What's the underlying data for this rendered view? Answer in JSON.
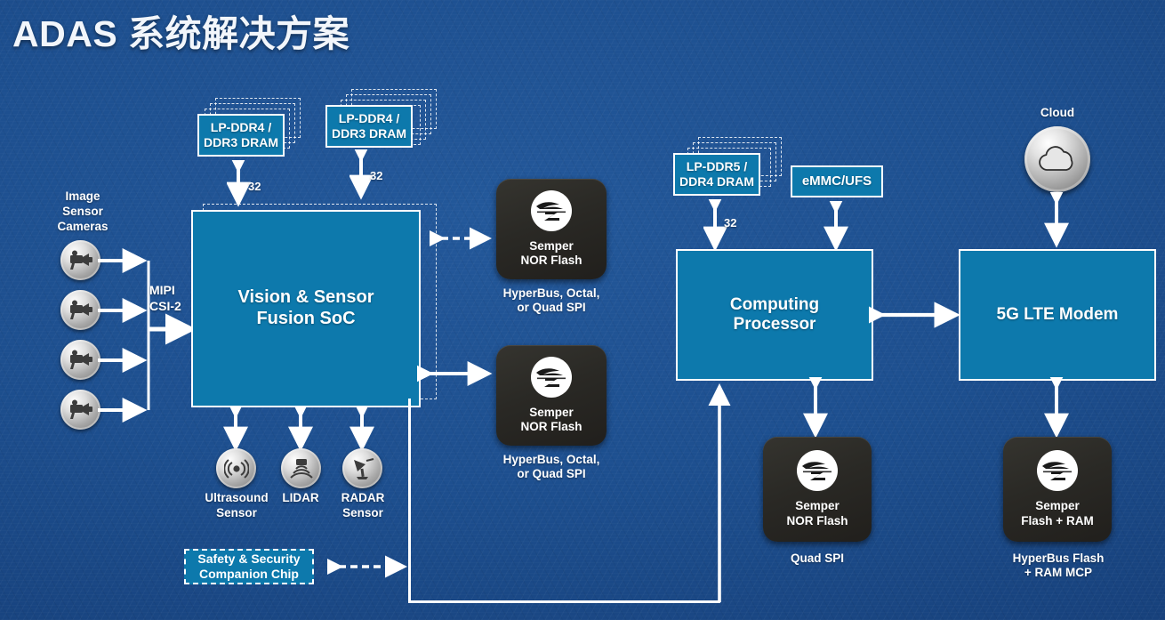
{
  "title": "ADAS 系统解决方案",
  "colors": {
    "background": "#1d4f8f",
    "box_fill": "#0d79ac",
    "box_border": "#ffffff",
    "chip_fill": "#2a2925",
    "text": "#ffffff"
  },
  "diagram": {
    "type": "block-diagram",
    "left_section": {
      "cameras_label": "Image\nSensor\nCameras",
      "cameras_label_lines": [
        "Image",
        "Sensor",
        "Cameras"
      ],
      "camera_count": 4,
      "camera_icon": "camera-icon",
      "interface_label_lines": [
        "MIPI",
        "CSI-2"
      ],
      "dram_blocks": [
        {
          "name": "dram-left",
          "lines": [
            "LP-DDR4 /",
            "DDR3 DRAM"
          ],
          "bus_width": "32",
          "stack_copies": 3
        },
        {
          "name": "dram-right",
          "lines": [
            "LP-DDR4 /",
            "DDR3 DRAM"
          ],
          "bus_width": "32",
          "stack_copies": 4
        }
      ],
      "soc": {
        "lines": [
          "Vision & Sensor",
          "Fusion SoC"
        ]
      },
      "sensors": [
        {
          "icon": "ultrasound-icon",
          "lines": [
            "Ultrasound",
            "Sensor"
          ]
        },
        {
          "icon": "lidar-icon",
          "lines": [
            "LIDAR"
          ]
        },
        {
          "icon": "radar-icon",
          "lines": [
            "RADAR",
            "Sensor"
          ]
        }
      ],
      "companion_chip": {
        "lines": [
          "Safety & Security",
          "Companion Chip"
        ]
      },
      "flash_modules": [
        {
          "logo": "cypress-logo-icon",
          "lines": [
            "Semper",
            "NOR Flash"
          ],
          "caption_lines": [
            "HyperBus, Octal,",
            "or Quad SPI"
          ],
          "link": "dashed"
        },
        {
          "logo": "cypress-logo-icon",
          "lines": [
            "Semper",
            "NOR Flash"
          ],
          "caption_lines": [
            "HyperBus, Octal,",
            "or Quad SPI"
          ],
          "link": "solid"
        }
      ]
    },
    "right_section": {
      "memory_blocks": [
        {
          "name": "dram-ddr5",
          "lines": [
            "LP-DDR5 /",
            "DDR4 DRAM"
          ],
          "bus_width": "32",
          "stack_copies": 3
        },
        {
          "name": "emmc-ufs",
          "lines": [
            "eMMC/UFS"
          ]
        }
      ],
      "processor": {
        "lines": [
          "Computing",
          "Processor"
        ]
      },
      "modem": {
        "lines": [
          "5G LTE Modem"
        ]
      },
      "cloud": {
        "label": "Cloud",
        "icon": "cloud-icon"
      },
      "flash_modules": [
        {
          "logo": "cypress-logo-icon",
          "lines": [
            "Semper",
            "NOR Flash"
          ],
          "caption_lines": [
            "Quad SPI"
          ]
        },
        {
          "logo": "cypress-logo-icon",
          "lines": [
            "Semper",
            "Flash + RAM"
          ],
          "caption_lines": [
            "HyperBus Flash",
            "+ RAM MCP"
          ]
        }
      ]
    }
  }
}
